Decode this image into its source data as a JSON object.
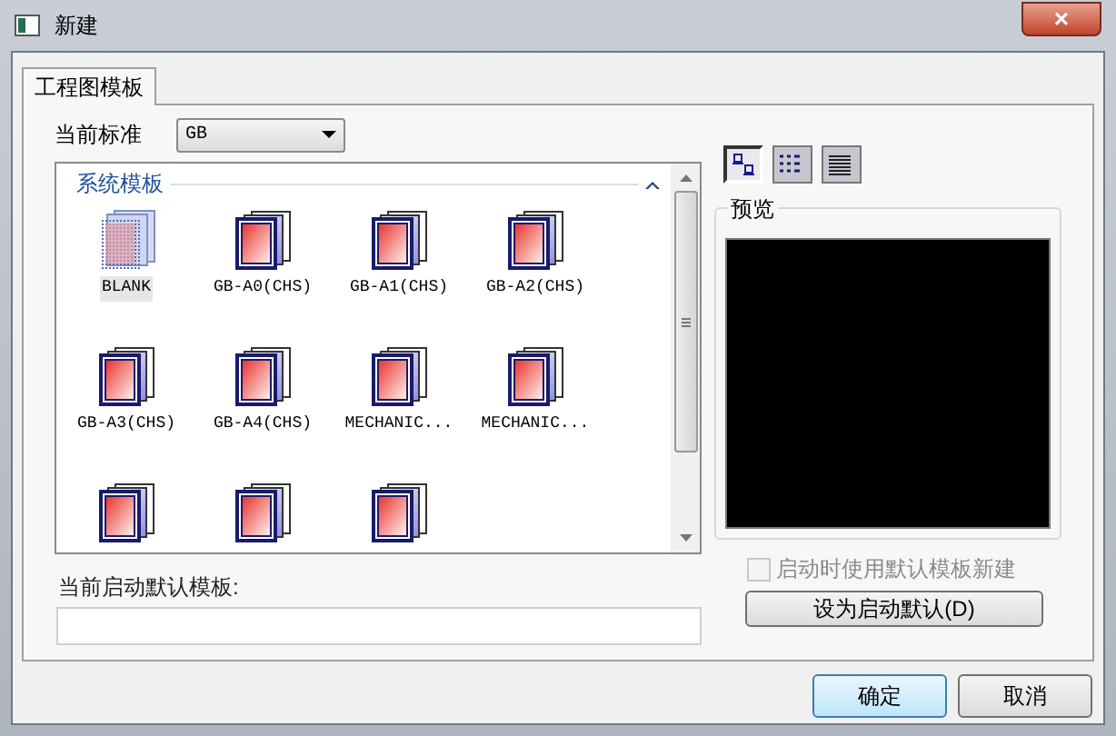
{
  "window": {
    "title": "新建",
    "close": "×"
  },
  "tabs": [
    {
      "label": "工程图模板",
      "selected": true
    }
  ],
  "standard": {
    "label": "当前标准",
    "value": "GB"
  },
  "template_list": {
    "group": "系统模板",
    "expanded": true,
    "items": [
      {
        "kind": "blank",
        "label": "BLANK",
        "selected": true
      },
      {
        "kind": "template",
        "label": "GB-A0(CHS)",
        "selected": false
      },
      {
        "kind": "template",
        "label": "GB-A1(CHS)",
        "selected": false
      },
      {
        "kind": "template",
        "label": "GB-A2(CHS)",
        "selected": false
      },
      {
        "kind": "template",
        "label": "GB-A3(CHS)",
        "selected": false
      },
      {
        "kind": "template",
        "label": "GB-A4(CHS)",
        "selected": false
      },
      {
        "kind": "template",
        "label": "MECHANIC...",
        "selected": false
      },
      {
        "kind": "template",
        "label": "MECHANIC...",
        "selected": false
      },
      {
        "kind": "template",
        "selected": false
      },
      {
        "kind": "template",
        "selected": false
      },
      {
        "kind": "template",
        "selected": false
      }
    ]
  },
  "view_buttons": [
    {
      "kind": "large",
      "selected": true
    },
    {
      "kind": "list",
      "selected": false
    },
    {
      "kind": "details",
      "selected": false
    }
  ],
  "preview": {
    "label": "预览"
  },
  "startup": {
    "label": "当前启动默认模板:",
    "checkbox": {
      "label": "启动时使用默认模板新建",
      "checked": false,
      "disabled": true
    },
    "button": "设为启动默认(D)"
  },
  "buttons": [
    {
      "label": "确定",
      "default": true
    },
    {
      "label": "取消",
      "default": false
    }
  ]
}
